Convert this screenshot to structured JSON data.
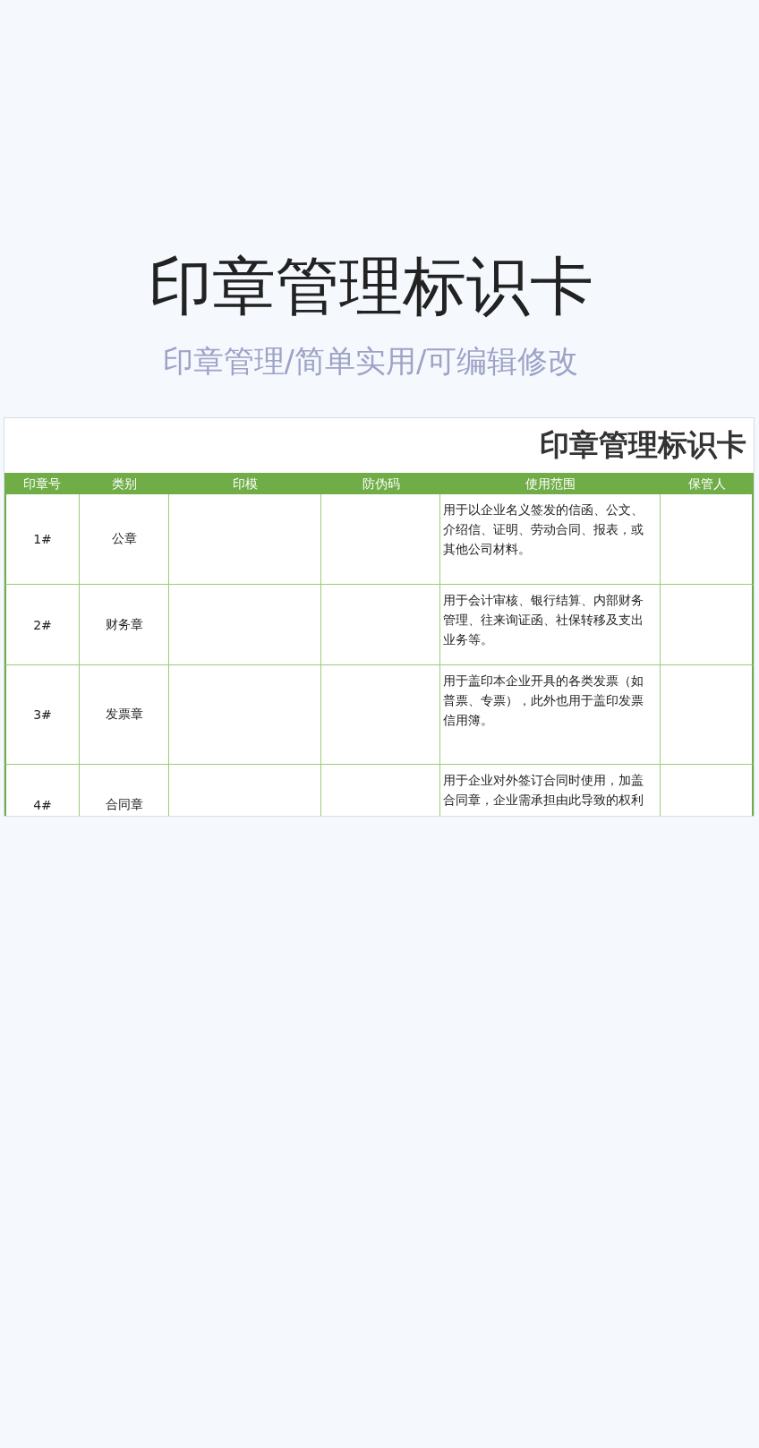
{
  "title": "印章管理标识卡",
  "subtitle": "印章管理/简单实用/可编辑修改",
  "card": {
    "title": "印章管理标识卡",
    "columns": [
      "印章号",
      "类别",
      "印模",
      "防伪码",
      "使用范围",
      "保管人"
    ],
    "rows": [
      {
        "number": "1#",
        "category": "公章",
        "scope": "用于以企业名义签发的信函、公文、介绍信、证明、劳动合同、报表，或其他公司材料。"
      },
      {
        "number": "2#",
        "category": "财务章",
        "scope": "用于会计审核、银行结算、内部财务管理、往来询证函、社保转移及支出业务等。"
      },
      {
        "number": "3#",
        "category": "发票章",
        "scope": "用于盖印本企业开具的各类发票（如普票、专票），此外也用于盖印发票信用簿。"
      },
      {
        "number": "4#",
        "category": "合同章",
        "scope": "用于企业对外签订合同时使用，加盖合同章，企业需承担由此导致的权利"
      }
    ]
  }
}
